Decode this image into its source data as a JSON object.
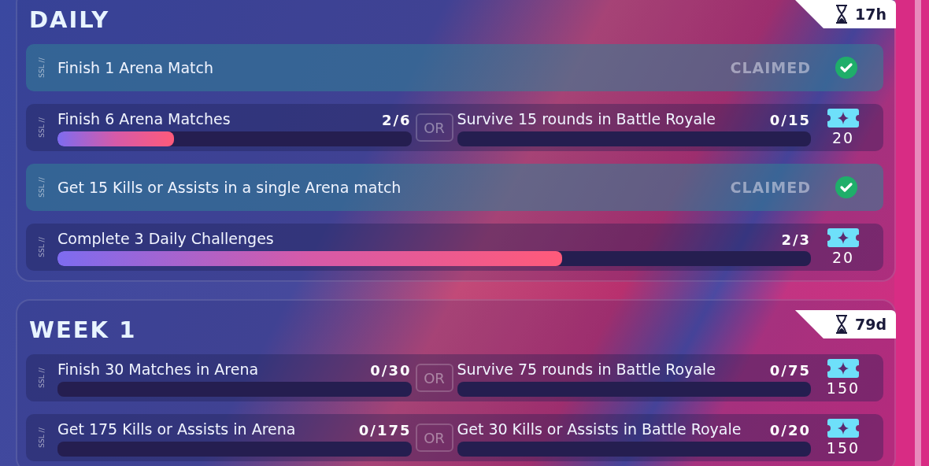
{
  "sections": [
    {
      "title": "DAILY",
      "timer": "17h",
      "rows": [
        {
          "kind": "claimed",
          "tag": "SSL //",
          "objective": "Finish 1 Arena Match",
          "status": "CLAIMED"
        },
        {
          "kind": "choice",
          "tag": "SSL //",
          "separator": "OR",
          "reward": "20",
          "objectives": [
            {
              "text": "Finish 6 Arena Matches",
              "progress": "2/6",
              "level": 0.33
            },
            {
              "text": "Survive 15 rounds in Battle Royale",
              "progress": "0/15"
            }
          ]
        },
        {
          "kind": "claimed",
          "tag": "SSL //",
          "objective": "Get 15 Kills or Assists in a single Arena match",
          "status": "CLAIMED"
        },
        {
          "kind": "single",
          "tag": "SSL //",
          "reward": "20",
          "objectives": [
            {
              "text": "Complete 3 Daily Challenges",
              "progress": "2/3",
              "level": 0.67
            }
          ]
        }
      ]
    },
    {
      "title": "WEEK 1",
      "timer": "79d",
      "rows": [
        {
          "kind": "choice",
          "tag": "SSL //",
          "separator": "OR",
          "reward": "150",
          "objectives": [
            {
              "text": "Finish 30 Matches in Arena",
              "progress": "0/30"
            },
            {
              "text": "Survive 75 rounds in Battle Royale",
              "progress": "0/75"
            }
          ]
        },
        {
          "kind": "choice",
          "tag": "SSL //",
          "separator": "OR",
          "reward": "150",
          "objectives": [
            {
              "text": "Get 175 Kills or Assists in Arena",
              "progress": "0/175"
            },
            {
              "text": "Get 30 Kills or Assists in Battle Royale",
              "progress": "0/20"
            }
          ]
        }
      ]
    }
  ]
}
